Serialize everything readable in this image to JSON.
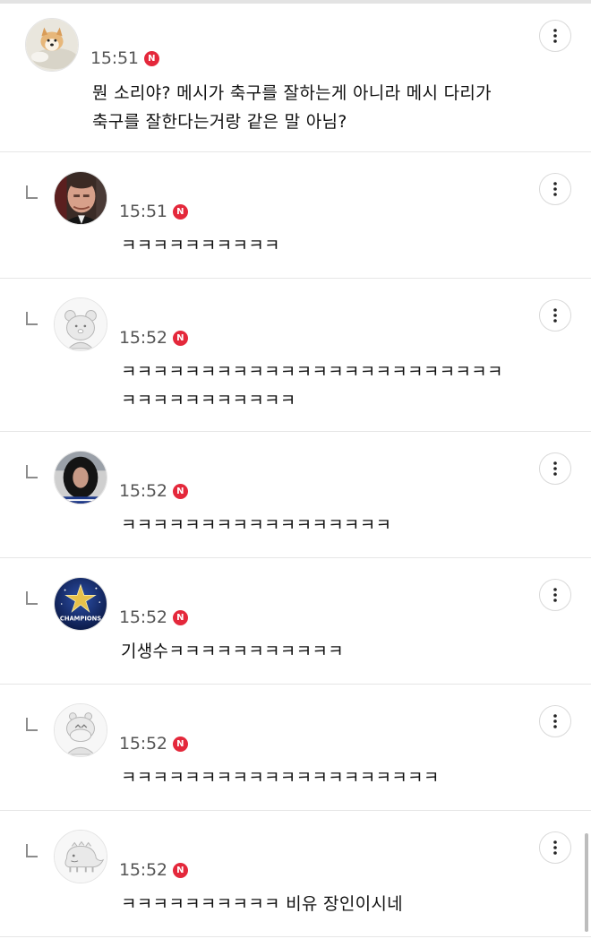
{
  "comments": [
    {
      "time": "15:51",
      "badge": "N",
      "text": "뭔 소리야? 메시가 축구를 잘하는게 아니라 메시 다리가\n축구를 잘한다는거랑 같은 말 아님?",
      "avatar": "dog-avatar-icon",
      "reply": false
    },
    {
      "time": "15:51",
      "badge": "N",
      "text": "ㅋㅋㅋㅋㅋㅋㅋㅋㅋㅋ",
      "avatar": "man-photo-avatar-icon",
      "reply": true
    },
    {
      "time": "15:52",
      "badge": "N",
      "text": "ㅋㅋㅋㅋㅋㅋㅋㅋㅋㅋㅋㅋㅋㅋㅋㅋㅋㅋㅋㅋㅋㅋㅋㅋ\nㅋㅋㅋㅋㅋㅋㅋㅋㅋㅋㅋ",
      "avatar": "default-avatar-bear-icon",
      "reply": true
    },
    {
      "time": "15:52",
      "badge": "N",
      "text": "ㅋㅋㅋㅋㅋㅋㅋㅋㅋㅋㅋㅋㅋㅋㅋㅋㅋ",
      "avatar": "person-photo-avatar-icon",
      "reply": true
    },
    {
      "time": "15:52",
      "badge": "N",
      "text": "기생수ㅋㅋㅋㅋㅋㅋㅋㅋㅋㅋㅋ",
      "avatar": "champions-logo-avatar-icon",
      "reply": true
    },
    {
      "time": "15:52",
      "badge": "N",
      "text": "ㅋㅋㅋㅋㅋㅋㅋㅋㅋㅋㅋㅋㅋㅋㅋㅋㅋㅋㅋㅋ",
      "avatar": "default-avatar-hippo-icon",
      "reply": true
    },
    {
      "time": "15:52",
      "badge": "N",
      "text": "ㅋㅋㅋㅋㅋㅋㅋㅋㅋㅋ 비유 장인이시네",
      "avatar": "default-avatar-dino-icon",
      "reply": true
    }
  ],
  "avatar_logo_text": "CHAMPIONS",
  "colors": {
    "badge": "#e4283b",
    "divider": "#e6e6e6",
    "time": "#555555"
  }
}
